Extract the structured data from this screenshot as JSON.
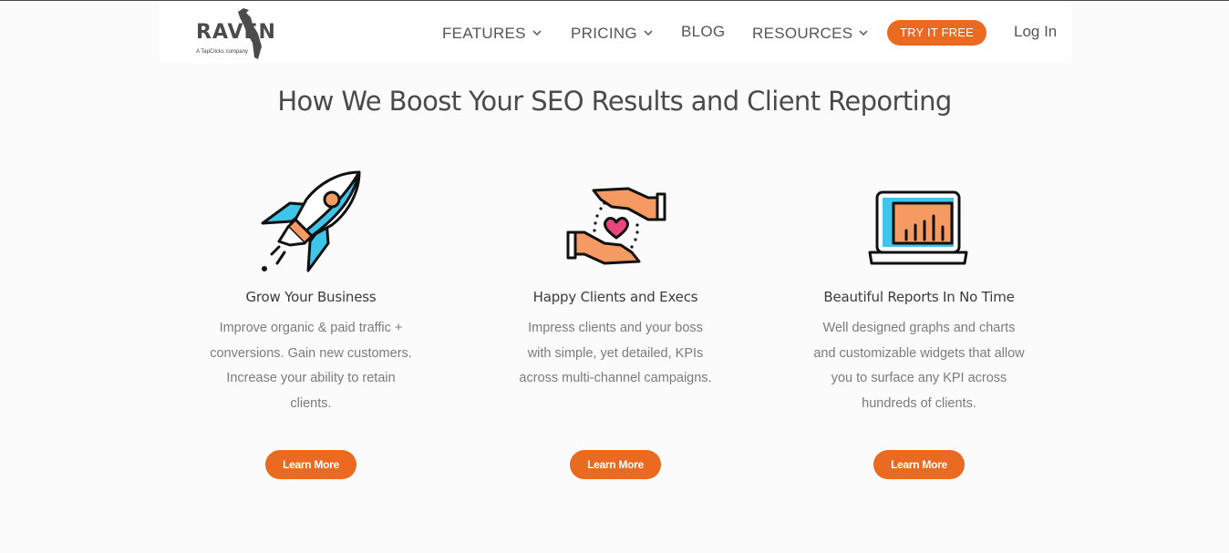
{
  "logo": {
    "word": "RAVEN",
    "sub": "A TapClicks company"
  },
  "nav": {
    "features": "FEATURES",
    "pricing": "PRICING",
    "blog": "BLOG",
    "resources": "RESOURCES",
    "try_free": "TRY IT FREE",
    "login": "Log In"
  },
  "headline": "How We Boost Your SEO Results and Client Reporting",
  "features": [
    {
      "icon": "rocket-icon",
      "title": "Grow Your Business",
      "desc": [
        "Improve organic & paid traffic +",
        "conversions. Gain new customers.",
        "Increase your ability to retain",
        "clients."
      ],
      "button": "Learn More"
    },
    {
      "icon": "hands-heart-icon",
      "title": "Happy Clients and Execs",
      "desc": [
        "Impress clients and your boss",
        "with simple, yet detailed, KPIs",
        "across multi-channel campaigns."
      ],
      "button": "Learn More"
    },
    {
      "icon": "laptop-chart-icon",
      "title": "Beautiful Reports In No Time",
      "desc": [
        "Well designed graphs and charts",
        "and customizable widgets that allow",
        "you to surface any KPI across",
        "hundreds of clients."
      ],
      "button": "Learn More"
    }
  ],
  "colors": {
    "accent": "#ea6a21",
    "cyan": "#3ec6ea",
    "orange_light": "#f59a62",
    "pink": "#e8467c"
  }
}
